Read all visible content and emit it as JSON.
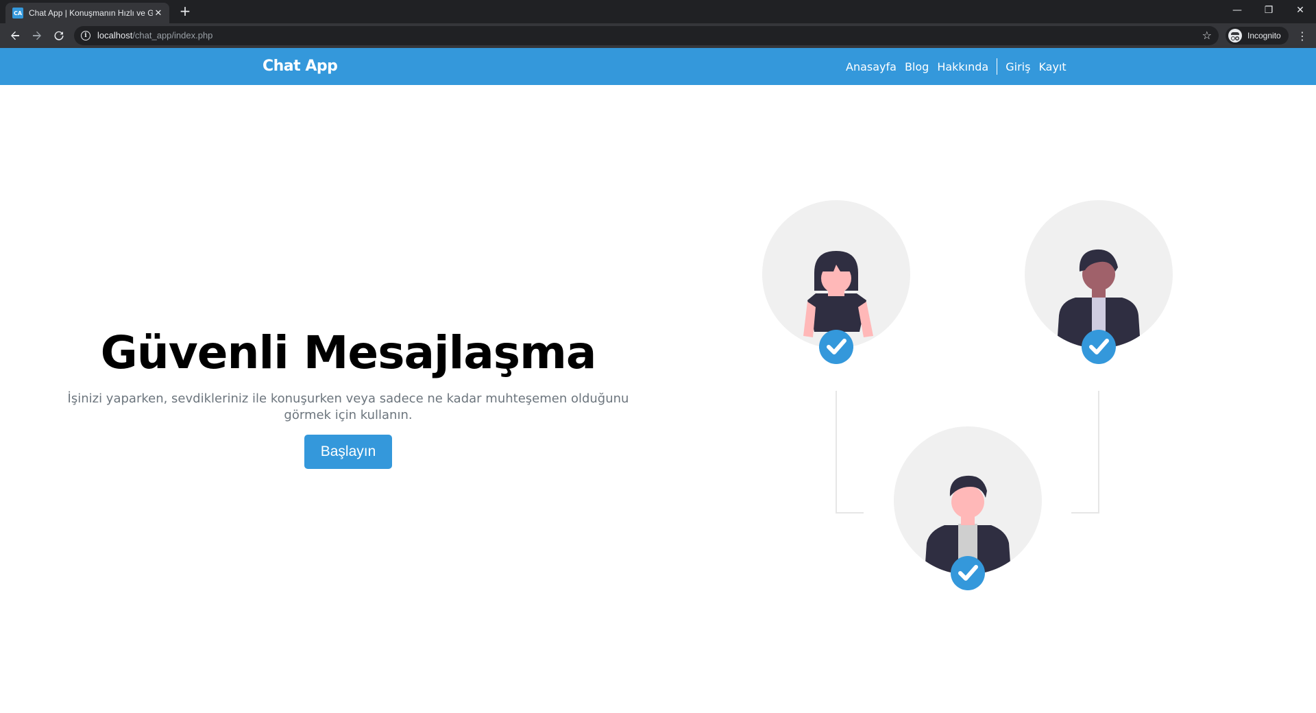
{
  "browser": {
    "tab_title": "Chat App | Konuşmanın Hızlı ve G",
    "favicon_text": "CA",
    "url_host": "localhost",
    "url_path": "/chat_app/index.php",
    "incognito_label": "Incognito"
  },
  "nav": {
    "brand": "Chat App",
    "links": [
      "Anasayfa",
      "Blog",
      "Hakkında"
    ],
    "auth_links": [
      "Giriş",
      "Kayıt"
    ]
  },
  "hero": {
    "title": "Güvenli Mesajlaşma",
    "subtitle": "İşinizi yaparken, sevdikleriniz ile konuşurken veya sadece ne kadar muhteşemen olduğunu görmek için kullanın.",
    "button": "Başlayın"
  },
  "colors": {
    "accent": "#3498db",
    "chrome_dark": "#202124",
    "chrome_light": "#35363a",
    "avatar_bg": "#f0f0f0",
    "suit": "#2f2e41",
    "skin": "#ffb8b8",
    "skin_dark": "#a0616a"
  },
  "icons": {
    "favicon": "chat-app-favicon",
    "back": "arrow-left-icon",
    "forward": "arrow-right-icon",
    "reload": "reload-icon",
    "info": "info-icon",
    "bookmark": "star-icon",
    "incognito": "incognito-icon",
    "menu": "kebab-menu-icon",
    "verified": "check-circle-icon"
  }
}
